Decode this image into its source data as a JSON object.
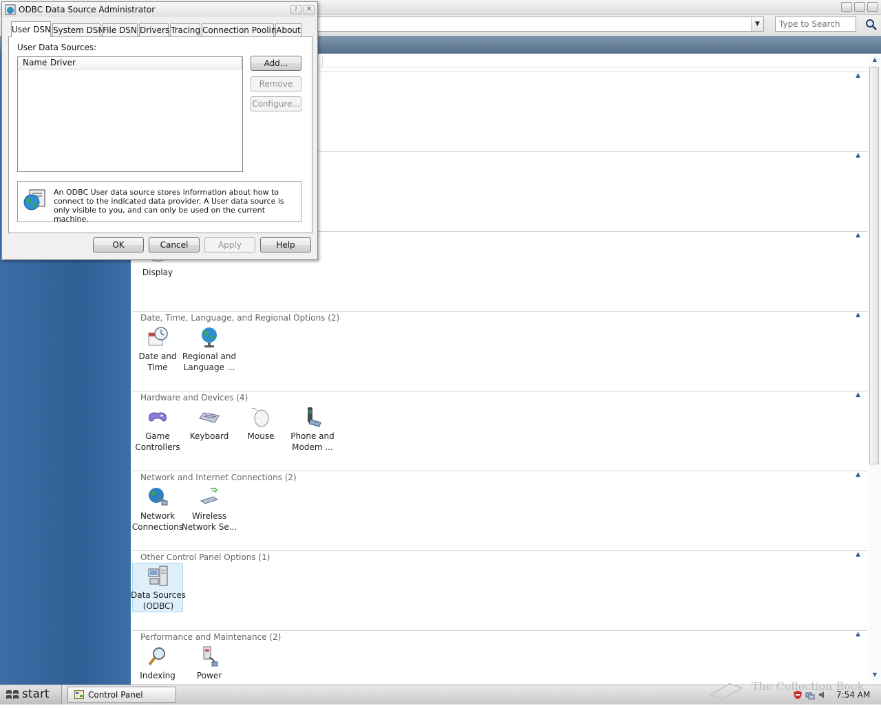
{
  "control_panel": {
    "search_placeholder": "Type to Search",
    "groups": [
      {
        "title": "",
        "items": [
          {
            "label": "Display"
          }
        ]
      },
      {
        "title": "Date, Time, Language, and Regional Options (2)",
        "items": [
          {
            "label": "Date and Time"
          },
          {
            "label": "Regional and Language ..."
          }
        ]
      },
      {
        "title": "Hardware and Devices (4)",
        "items": [
          {
            "label": "Game Controllers"
          },
          {
            "label": "Keyboard"
          },
          {
            "label": "Mouse"
          },
          {
            "label": "Phone and Modem ..."
          }
        ]
      },
      {
        "title": "Network and Internet Connections (2)",
        "items": [
          {
            "label": "Network Connections"
          },
          {
            "label": "Wireless Network Se..."
          }
        ]
      },
      {
        "title": "Other Control Panel Options (1)",
        "items": [
          {
            "label": "Data Sources (ODBC)",
            "selected": true
          }
        ]
      },
      {
        "title": "Performance and Maintenance (2)",
        "items": [
          {
            "label": "Indexing"
          },
          {
            "label": "Power"
          }
        ]
      }
    ]
  },
  "odbc_dialog": {
    "title": "ODBC Data Source Administrator",
    "help_glyph": "?",
    "close_glyph": "✕",
    "tabs": [
      {
        "label": "User DSN",
        "active": true
      },
      {
        "label": "System DSN"
      },
      {
        "label": "File DSN"
      },
      {
        "label": "Drivers"
      },
      {
        "label": "Tracing"
      },
      {
        "label": "Connection Pooling"
      },
      {
        "label": "About"
      }
    ],
    "user_data_sources_label": "User Data Sources:",
    "list_columns": [
      "Name",
      "Driver"
    ],
    "side_buttons": {
      "add": "Add...",
      "remove": "Remove",
      "configure": "Configure..."
    },
    "info_text": "An ODBC User data source stores information about how to connect to the indicated data provider.   A User data source is only visible to you, and can only be used on the current machine.",
    "footer_buttons": {
      "ok": "OK",
      "cancel": "Cancel",
      "apply": "Apply",
      "help": "Help"
    }
  },
  "taskbar": {
    "start_label": "start",
    "tasks": [
      {
        "label": "Control Panel"
      }
    ],
    "watermark": "The Collection Book",
    "clock": "7:54 AM"
  },
  "colors": {
    "side_pane": "#2f5f95",
    "toolbar": "#56708b",
    "selection": "#dff0fb"
  }
}
